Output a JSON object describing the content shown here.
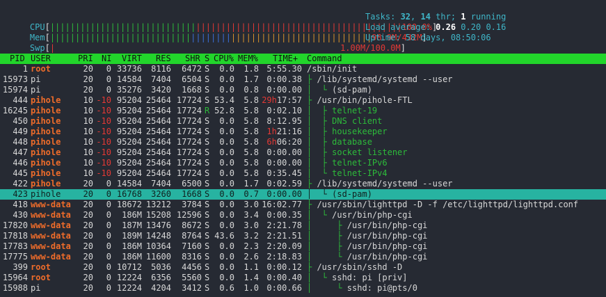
{
  "meters": [
    {
      "label": "CPU",
      "bar": "||||||||||||||||||||||||||||||||||||||||||||||||||||||||||||||||||||||",
      "value": "100.0%"
    },
    {
      "label": "Mem",
      "bar": "||||||||||||||||||||||||||||||||||||||||||||||||||||||||||||||||",
      "value": "98.9M/432M"
    },
    {
      "label": "Swp",
      "bar": "|",
      "value": "1.00M/100.0M"
    }
  ],
  "tasks": {
    "label": "Tasks: ",
    "tasks": "32",
    "sep": ", ",
    "threads": "14",
    "thr_label": " thr; ",
    "running": "1",
    "running_label": " running"
  },
  "load": {
    "label": "Load average: ",
    "l1": "0.26",
    "l5": "0.20",
    "l15": "0.16"
  },
  "uptime": {
    "label": "Uptime: ",
    "value": "58 days, 08:50:06"
  },
  "columns": [
    "PID",
    "USER",
    "PRI",
    "NI",
    "VIRT",
    "RES",
    "SHR",
    "S",
    "CPU%",
    "MEM%",
    "TIME+",
    "Command"
  ],
  "processes": [
    {
      "pid": "1",
      "user": "root",
      "pri": "20",
      "ni": "0",
      "virt": "33736",
      "res": "8116",
      "shr": "6472",
      "s": "S",
      "cpu": "0.0",
      "mem": "1.8",
      "time": "5:55.30",
      "tree": "",
      "cmd": "/sbin/init"
    },
    {
      "pid": "15973",
      "user": "pi",
      "pri": "20",
      "ni": "0",
      "virt": "14584",
      "res": "7404",
      "shr": "6504",
      "s": "S",
      "cpu": "0.0",
      "mem": "1.7",
      "time": "0:00.38",
      "tree": "├ ",
      "cmd": "/lib/systemd/systemd --user"
    },
    {
      "pid": "15974",
      "user": "pi",
      "pri": "20",
      "ni": "0",
      "virt": "35276",
      "res": "3420",
      "shr": "1668",
      "s": "S",
      "cpu": "0.0",
      "mem": "0.8",
      "time": "0:00.00",
      "tree": "│  └ ",
      "cmd": "(sd-pam)"
    },
    {
      "pid": "444",
      "user": "pihole",
      "pri": "10",
      "ni": "-10",
      "virt": "95204",
      "res": "25464",
      "shr": "17724",
      "s": "S",
      "cpu": "53.4",
      "mem": "5.8",
      "time": "29h17:57",
      "tree": "├ ",
      "cmd": "/usr/bin/pihole-FTL"
    },
    {
      "pid": "16245",
      "user": "pihole",
      "pri": "10",
      "ni": "-10",
      "virt": "95204",
      "res": "25464",
      "shr": "17724",
      "s": "R",
      "cpu": "52.8",
      "mem": "5.8",
      "time": "0:02.10",
      "tree": "│  ├ ",
      "cmd": "telnet-19",
      "thread": true
    },
    {
      "pid": "450",
      "user": "pihole",
      "pri": "10",
      "ni": "-10",
      "virt": "95204",
      "res": "25464",
      "shr": "17724",
      "s": "S",
      "cpu": "0.0",
      "mem": "5.8",
      "time": "8:12.95",
      "tree": "│  ├ ",
      "cmd": "DNS client",
      "thread": true
    },
    {
      "pid": "449",
      "user": "pihole",
      "pri": "10",
      "ni": "-10",
      "virt": "95204",
      "res": "25464",
      "shr": "17724",
      "s": "S",
      "cpu": "0.0",
      "mem": "5.8",
      "time": "1h21:16",
      "tree": "│  ├ ",
      "cmd": "housekeeper",
      "thread": true
    },
    {
      "pid": "448",
      "user": "pihole",
      "pri": "10",
      "ni": "-10",
      "virt": "95204",
      "res": "25464",
      "shr": "17724",
      "s": "S",
      "cpu": "0.0",
      "mem": "5.8",
      "time": "6h06:20",
      "tree": "│  ├ ",
      "cmd": "database",
      "thread": true
    },
    {
      "pid": "447",
      "user": "pihole",
      "pri": "10",
      "ni": "-10",
      "virt": "95204",
      "res": "25464",
      "shr": "17724",
      "s": "S",
      "cpu": "0.0",
      "mem": "5.8",
      "time": "0:00.00",
      "tree": "│  ├ ",
      "cmd": "socket listener",
      "thread": true
    },
    {
      "pid": "446",
      "user": "pihole",
      "pri": "10",
      "ni": "-10",
      "virt": "95204",
      "res": "25464",
      "shr": "17724",
      "s": "S",
      "cpu": "0.0",
      "mem": "5.8",
      "time": "0:00.00",
      "tree": "│  ├ ",
      "cmd": "telnet-IPv6",
      "thread": true
    },
    {
      "pid": "445",
      "user": "pihole",
      "pri": "10",
      "ni": "-10",
      "virt": "95204",
      "res": "25464",
      "shr": "17724",
      "s": "S",
      "cpu": "0.0",
      "mem": "5.8",
      "time": "0:35.45",
      "tree": "│  └ ",
      "cmd": "telnet-IPv4",
      "thread": true
    },
    {
      "pid": "422",
      "user": "pihole",
      "pri": "20",
      "ni": "0",
      "virt": "14584",
      "res": "7404",
      "shr": "6500",
      "s": "S",
      "cpu": "0.0",
      "mem": "1.7",
      "time": "0:02.59",
      "tree": "├ ",
      "cmd": "/lib/systemd/systemd --user"
    },
    {
      "pid": "423",
      "user": "pihole",
      "pri": "20",
      "ni": "0",
      "virt": "16768",
      "res": "3260",
      "shr": "1668",
      "s": "S",
      "cpu": "0.0",
      "mem": "0.7",
      "time": "0:00.00",
      "tree": "│  └ ",
      "cmd": "(sd-pam)",
      "selected": true
    },
    {
      "pid": "418",
      "user": "www-data",
      "pri": "20",
      "ni": "0",
      "virt": "18672",
      "res": "13212",
      "shr": "3784",
      "s": "S",
      "cpu": "0.0",
      "mem": "3.0",
      "time": "16:02.77",
      "tree": "├ ",
      "cmd": "/usr/sbin/lighttpd -D -f /etc/lighttpd/lighttpd.conf"
    },
    {
      "pid": "430",
      "user": "www-data",
      "pri": "20",
      "ni": "0",
      "virt": "186M",
      "res": "15208",
      "shr": "12596",
      "s": "S",
      "cpu": "0.0",
      "mem": "3.4",
      "time": "0:00.35",
      "tree": "│  └ ",
      "cmd": "/usr/bin/php-cgi"
    },
    {
      "pid": "17820",
      "user": "www-data",
      "pri": "20",
      "ni": "0",
      "virt": "187M",
      "res": "13476",
      "shr": "8672",
      "s": "S",
      "cpu": "0.0",
      "mem": "3.0",
      "time": "2:21.78",
      "tree": "│     ├ ",
      "cmd": "/usr/bin/php-cgi"
    },
    {
      "pid": "17818",
      "user": "www-data",
      "pri": "20",
      "ni": "0",
      "virt": "189M",
      "res": "14248",
      "shr": "8764",
      "s": "S",
      "cpu": "43.6",
      "mem": "3.2",
      "time": "2:21.51",
      "tree": "│     ├ ",
      "cmd": "/usr/bin/php-cgi"
    },
    {
      "pid": "17783",
      "user": "www-data",
      "pri": "20",
      "ni": "0",
      "virt": "186M",
      "res": "10364",
      "shr": "7160",
      "s": "S",
      "cpu": "0.0",
      "mem": "2.3",
      "time": "2:20.09",
      "tree": "│     ├ ",
      "cmd": "/usr/bin/php-cgi"
    },
    {
      "pid": "17775",
      "user": "www-data",
      "pri": "20",
      "ni": "0",
      "virt": "186M",
      "res": "11600",
      "shr": "8316",
      "s": "S",
      "cpu": "0.0",
      "mem": "2.6",
      "time": "2:18.83",
      "tree": "│     └ ",
      "cmd": "/usr/bin/php-cgi"
    },
    {
      "pid": "399",
      "user": "root",
      "pri": "20",
      "ni": "0",
      "virt": "10712",
      "res": "5036",
      "shr": "4456",
      "s": "S",
      "cpu": "0.0",
      "mem": "1.1",
      "time": "0:00.12",
      "tree": "├ ",
      "cmd": "/usr/sbin/sshd -D"
    },
    {
      "pid": "15964",
      "user": "root",
      "pri": "20",
      "ni": "0",
      "virt": "12224",
      "res": "6356",
      "shr": "5560",
      "s": "S",
      "cpu": "0.0",
      "mem": "1.4",
      "time": "0:00.40",
      "tree": "│  └ ",
      "cmd": "sshd: pi [priv]"
    },
    {
      "pid": "15988",
      "user": "pi",
      "pri": "20",
      "ni": "0",
      "virt": "12224",
      "res": "4204",
      "shr": "3412",
      "s": "S",
      "cpu": "0.6",
      "mem": "1.0",
      "time": "0:00.66",
      "tree": "│     └ ",
      "cmd": "sshd: pi@pts/0"
    }
  ]
}
